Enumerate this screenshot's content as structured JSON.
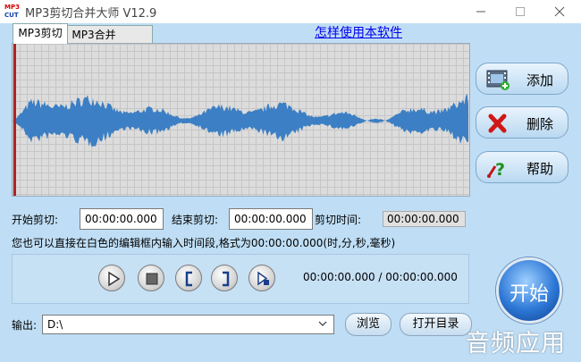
{
  "window": {
    "logo_text": "MP3\nCUT",
    "title": "MP3剪切合并大师 V12.9"
  },
  "tabs": [
    {
      "label": "MP3剪切",
      "active": true
    },
    {
      "label": "MP3合并",
      "active": false
    }
  ],
  "help_link": "怎样使用本软件",
  "side_buttons": {
    "add": {
      "label": "添加",
      "icon": "film-add-icon"
    },
    "delete": {
      "label": "删除",
      "icon": "red-x-icon"
    },
    "help": {
      "label": "帮助",
      "icon": "help-question-icon"
    }
  },
  "time_row": {
    "start_label": "开始剪切:",
    "start_value": "00:00:00.000",
    "end_label": "结束剪切:",
    "end_value": "00:00:00.000",
    "duration_label": "剪切时间:",
    "duration_value": "00:00:00.000"
  },
  "hint": "您也可以直接在白色的编辑框内输入时间段,格式为00:00:00.000(时,分,秒,毫秒)",
  "transport": {
    "buttons": [
      "play-icon",
      "stop-icon",
      "mark-start-icon",
      "mark-end-icon",
      "play-selection-icon"
    ],
    "time_display": "00:00:00.000 / 00:00:00.000"
  },
  "start_button": "开始",
  "output": {
    "label": "输出:",
    "path": "D:\\",
    "browse": "浏览",
    "open_dir": "打开目录"
  },
  "watermark": "音频应用",
  "colors": {
    "waveform": "#3c7fc4",
    "playhead": "#b22222",
    "link": "#0000ee"
  }
}
